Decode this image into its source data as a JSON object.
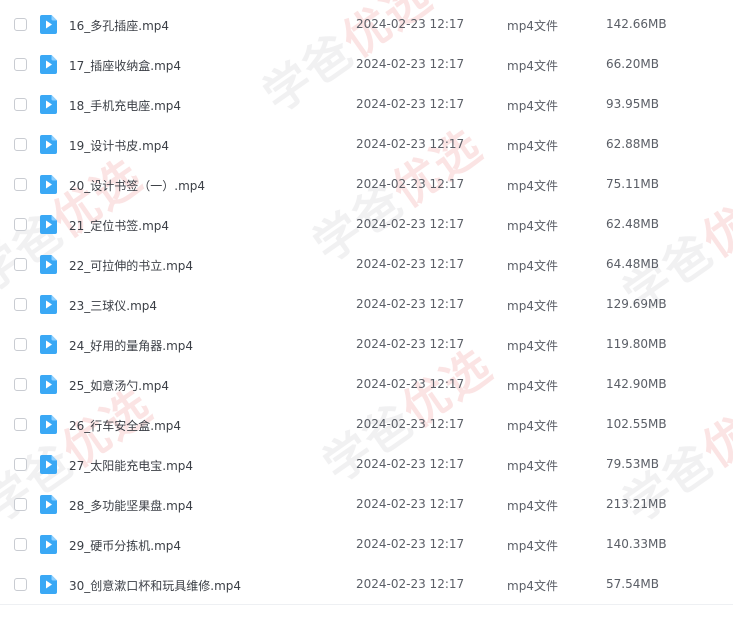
{
  "files": [
    {
      "name": "16_多孔插座.mp4",
      "date": "2024-02-23 12:17",
      "type": "mp4文件",
      "size": "142.66MB"
    },
    {
      "name": "17_插座收纳盒.mp4",
      "date": "2024-02-23 12:17",
      "type": "mp4文件",
      "size": "66.20MB"
    },
    {
      "name": "18_手机充电座.mp4",
      "date": "2024-02-23 12:17",
      "type": "mp4文件",
      "size": "93.95MB"
    },
    {
      "name": "19_设计书皮.mp4",
      "date": "2024-02-23 12:17",
      "type": "mp4文件",
      "size": "62.88MB"
    },
    {
      "name": "20_设计书签（一）.mp4",
      "date": "2024-02-23 12:17",
      "type": "mp4文件",
      "size": "75.11MB"
    },
    {
      "name": "21_定位书签.mp4",
      "date": "2024-02-23 12:17",
      "type": "mp4文件",
      "size": "62.48MB"
    },
    {
      "name": "22_可拉伸的书立.mp4",
      "date": "2024-02-23 12:17",
      "type": "mp4文件",
      "size": "64.48MB"
    },
    {
      "name": "23_三球仪.mp4",
      "date": "2024-02-23 12:17",
      "type": "mp4文件",
      "size": "129.69MB"
    },
    {
      "name": "24_好用的量角器.mp4",
      "date": "2024-02-23 12:17",
      "type": "mp4文件",
      "size": "119.80MB"
    },
    {
      "name": "25_如意汤勺.mp4",
      "date": "2024-02-23 12:17",
      "type": "mp4文件",
      "size": "142.90MB"
    },
    {
      "name": "26_行车安全盒.mp4",
      "date": "2024-02-23 12:17",
      "type": "mp4文件",
      "size": "102.55MB"
    },
    {
      "name": "27_太阳能充电宝.mp4",
      "date": "2024-02-23 12:17",
      "type": "mp4文件",
      "size": "79.53MB"
    },
    {
      "name": "28_多功能坚果盘.mp4",
      "date": "2024-02-23 12:17",
      "type": "mp4文件",
      "size": "213.21MB"
    },
    {
      "name": "29_硬币分拣机.mp4",
      "date": "2024-02-23 12:17",
      "type": "mp4文件",
      "size": "140.33MB"
    },
    {
      "name": "30_创意漱口杯和玩具维修.mp4",
      "date": "2024-02-23 12:17",
      "type": "mp4文件",
      "size": "57.54MB"
    }
  ],
  "watermark": {
    "text_main": "学爸",
    "text_accent": "优选"
  },
  "icons": {
    "file_icon": "video-file-icon",
    "file_icon_color": "#3aa8f5"
  }
}
